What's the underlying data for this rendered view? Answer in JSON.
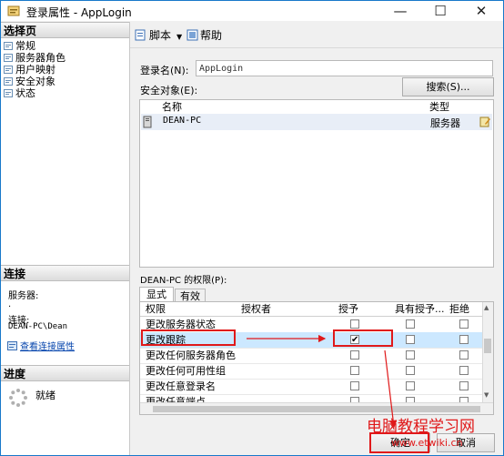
{
  "window": {
    "title": "登录属性 - AppLogin",
    "minimize_glyph": "—",
    "maximize_glyph": "☐",
    "close_glyph": "✕"
  },
  "select_page": {
    "header": "选择页",
    "items": [
      {
        "label": "常规"
      },
      {
        "label": "服务器角色"
      },
      {
        "label": "用户映射"
      },
      {
        "label": "安全对象"
      },
      {
        "label": "状态"
      }
    ]
  },
  "connection": {
    "header": "连接",
    "server_label": "服务器:",
    "server_value": ".",
    "connection_label": "连接:",
    "connection_value": "DEAN-PC\\Dean",
    "view_link": "查看连接属性"
  },
  "progress": {
    "header": "进度",
    "status": "就绪"
  },
  "toolbar": {
    "script_label": "脚本",
    "help_label": "帮助"
  },
  "login": {
    "label": "登录名(N):",
    "value": "AppLogin"
  },
  "securables": {
    "label": "安全对象(E):",
    "search_button": "搜索(S)...",
    "columns": [
      "名称",
      "类型"
    ],
    "rows": [
      {
        "name": "DEAN-PC",
        "type": "服务器"
      }
    ]
  },
  "permissions": {
    "label": "DEAN-PC 的权限(P):",
    "tabs": [
      "显式",
      "有效"
    ],
    "columns": [
      "权限",
      "授权者",
      "授予",
      "具有授予...",
      "拒绝"
    ],
    "rows": [
      {
        "name": "更改服务器状态",
        "grant": false,
        "with_grant": false,
        "deny": false
      },
      {
        "name": "更改跟踪",
        "grant": true,
        "with_grant": false,
        "deny": false
      },
      {
        "name": "更改任何服务器角色",
        "grant": false,
        "with_grant": false,
        "deny": false
      },
      {
        "name": "更改任何可用性组",
        "grant": false,
        "with_grant": false,
        "deny": false
      },
      {
        "name": "更改任意登录名",
        "grant": false,
        "with_grant": false,
        "deny": false
      },
      {
        "name": "更改任意端点",
        "grant": false,
        "with_grant": false,
        "deny": false
      }
    ],
    "check_glyph": "✔"
  },
  "footer": {
    "ok_button": "确定",
    "cancel_button": "取消"
  },
  "watermark": {
    "line1": "电脑教程学习网",
    "line2": "www.etwiki.cn"
  },
  "colors": {
    "accent": "#1979ca",
    "selection": "#cce8ff",
    "annotation_red": "#e0191a",
    "link": "#0645ad"
  }
}
